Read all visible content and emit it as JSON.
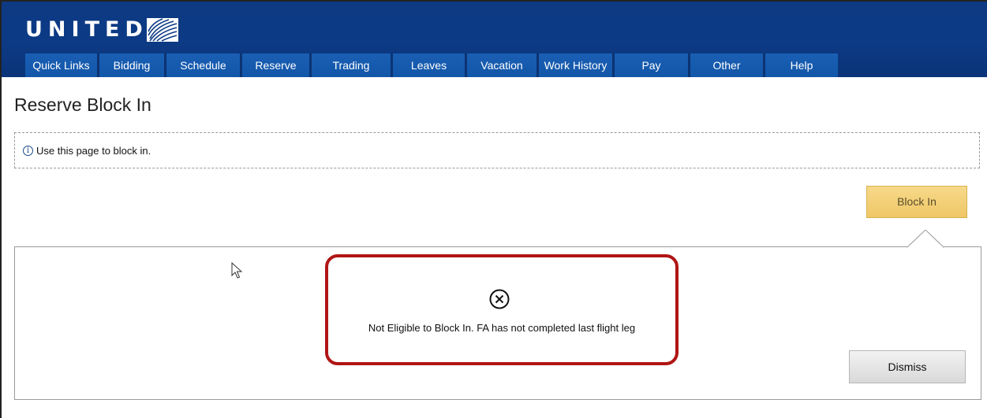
{
  "brand": {
    "name": "UNITED",
    "logo_icon": "globe-logo-icon"
  },
  "nav": {
    "items": [
      {
        "label": "Quick Links"
      },
      {
        "label": "Bidding"
      },
      {
        "label": "Schedule"
      },
      {
        "label": "Reserve"
      },
      {
        "label": "Trading"
      },
      {
        "label": "Leaves"
      },
      {
        "label": "Vacation"
      },
      {
        "label": "Work History"
      },
      {
        "label": "Pay"
      },
      {
        "label": "Other"
      },
      {
        "label": "Help"
      }
    ]
  },
  "page": {
    "title": "Reserve Block In",
    "info_text": "Use this page to block in.",
    "info_icon": "info-icon"
  },
  "actions": {
    "block_in_label": "Block In",
    "dismiss_label": "Dismiss"
  },
  "alert": {
    "icon": "error-x-icon",
    "message": "Not Eligible to Block In. FA has not completed last flight leg"
  },
  "colors": {
    "header_blue": "#0c3a84",
    "nav_blue": "#1a5fb4",
    "block_in_button": "#f2cd74",
    "alert_border": "#b01515"
  }
}
